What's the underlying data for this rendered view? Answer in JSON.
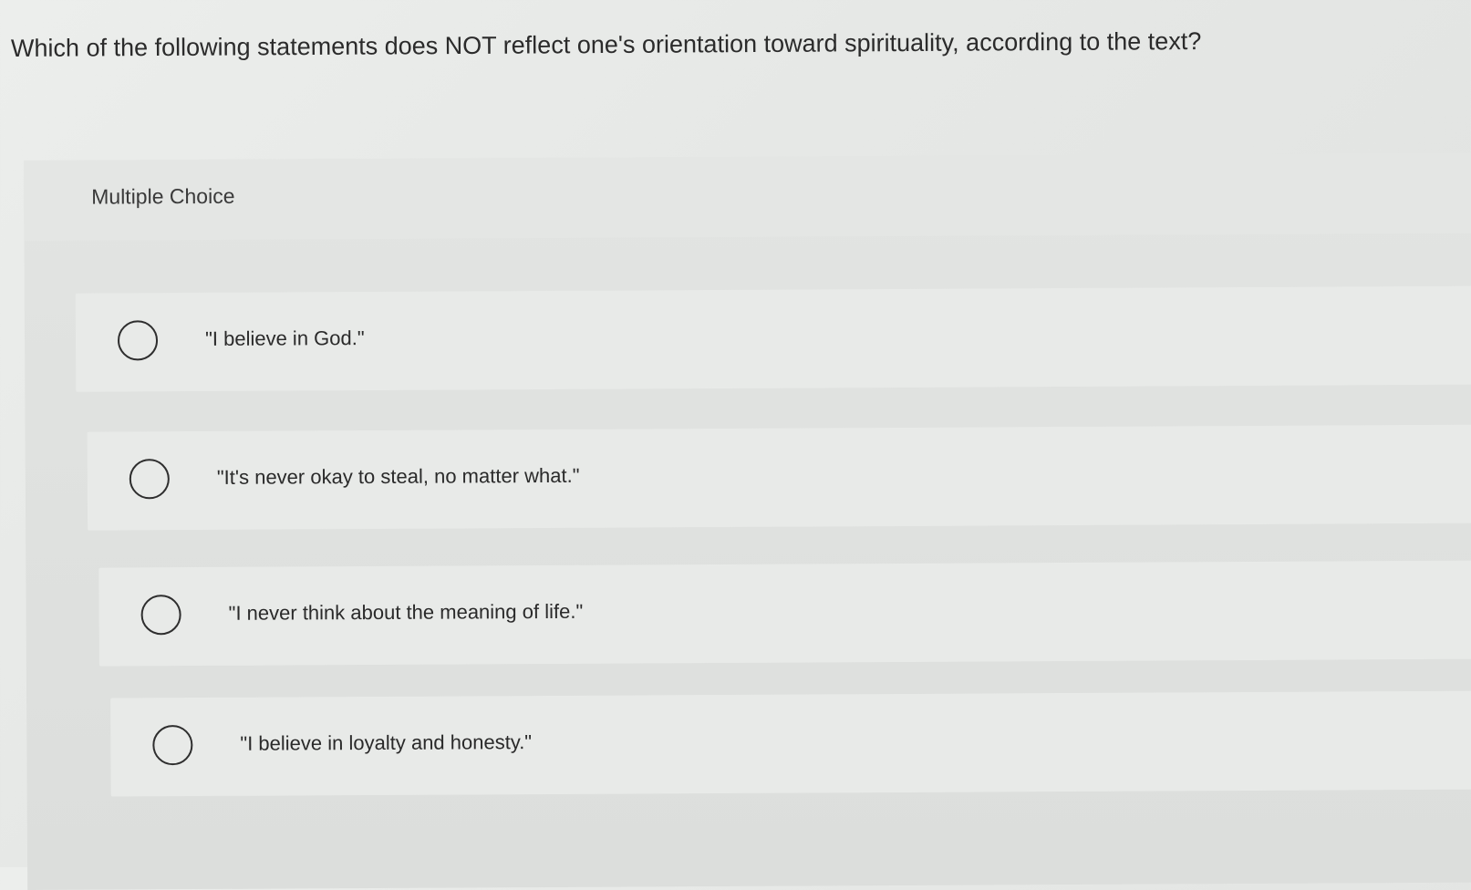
{
  "question": {
    "text": "Which of the following statements does NOT reflect one's orientation toward spirituality, according to the text?"
  },
  "panel": {
    "type_label": "Multiple Choice"
  },
  "options": [
    {
      "label": "\"I believe in God.\""
    },
    {
      "label": "\"It's never okay to steal, no matter what.\""
    },
    {
      "label": "\"I never think about the meaning of life.\""
    },
    {
      "label": "\"I believe in loyalty and honesty.\""
    }
  ]
}
